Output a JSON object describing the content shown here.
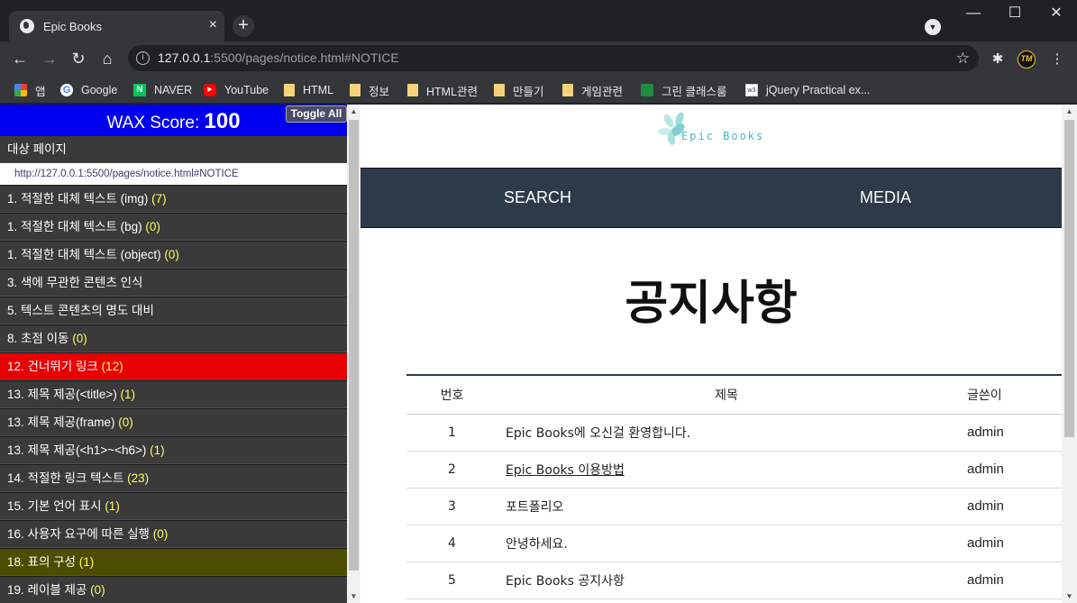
{
  "browser": {
    "tab_title": "Epic Books",
    "url_host": "127.0.0.1",
    "url_path": ":5500/pages/notice.html#NOTICE",
    "bookmarks": [
      "앱",
      "Google",
      "NAVER",
      "YouTube",
      "HTML",
      "정보",
      "HTML관련",
      "만들기",
      "게임관련",
      "그린 클래스룸",
      "jQuery Practical ex..."
    ]
  },
  "wax": {
    "score_label": "WAX Score:",
    "score_value": "100",
    "toggle_label": "Toggle All",
    "target_page_label": "대상 페이지",
    "target_url": "http://127.0.0.1:5500/pages/notice.html#NOTICE",
    "items": [
      {
        "label": "1. 적절한 대체 텍스트 (img)",
        "count": "(7)"
      },
      {
        "label": "1. 적절한 대체 텍스트 (bg)",
        "count": "(0)"
      },
      {
        "label": "1. 적절한 대체 텍스트 (object)",
        "count": "(0)"
      },
      {
        "label": "3. 색에 무관한 콘텐츠 인식",
        "count": ""
      },
      {
        "label": "5. 텍스트 콘텐츠의 명도 대비",
        "count": ""
      },
      {
        "label": "8. 초점 이동",
        "count": "(0)"
      },
      {
        "label": "12. 건너뛰기 링크",
        "count": "(12)"
      },
      {
        "label": "13. 제목 제공(<title>)",
        "count": "(1)"
      },
      {
        "label": "13. 제목 제공(frame)",
        "count": "(0)"
      },
      {
        "label": "13. 제목 제공(<h1>~<h6>)",
        "count": "(1)"
      },
      {
        "label": "14. 적절한 링크 텍스트",
        "count": "(23)"
      },
      {
        "label": "15. 기본 언어 표시",
        "count": "(1)"
      },
      {
        "label": "16. 사용자 요구에 따른 실행",
        "count": "(0)"
      },
      {
        "label": "18. 표의 구성",
        "count": "(1)"
      },
      {
        "label": "19. 레이블 제공",
        "count": "(0)"
      }
    ]
  },
  "site": {
    "logo_text": "Epic Books",
    "nav": [
      "SEARCH",
      "MEDIA"
    ],
    "page_title": "공지사항",
    "table": {
      "headers": [
        "번호",
        "제목",
        "글쓴이"
      ],
      "rows": [
        [
          "1",
          "Epic Books에 오신걸 환영합니다.",
          "admin"
        ],
        [
          "2",
          "Epic Books 이용방법",
          "admin"
        ],
        [
          "3",
          "포트폴리오",
          "admin"
        ],
        [
          "4",
          "안녕하세요.",
          "admin"
        ],
        [
          "5",
          "Epic Books 공지사항",
          "admin"
        ]
      ]
    }
  }
}
